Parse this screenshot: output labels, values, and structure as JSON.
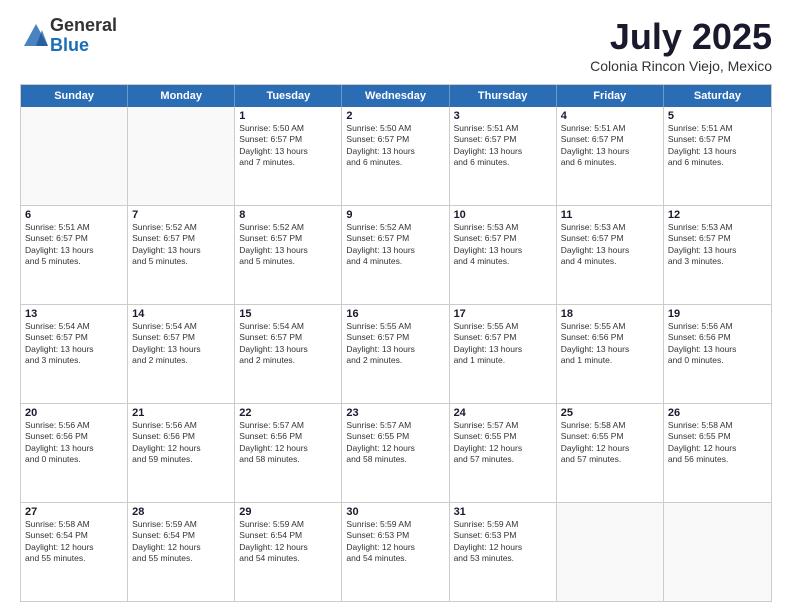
{
  "logo": {
    "general": "General",
    "blue": "Blue"
  },
  "title": "July 2025",
  "subtitle": "Colonia Rincon Viejo, Mexico",
  "header_days": [
    "Sunday",
    "Monday",
    "Tuesday",
    "Wednesday",
    "Thursday",
    "Friday",
    "Saturday"
  ],
  "weeks": [
    [
      {
        "day": "",
        "info": ""
      },
      {
        "day": "",
        "info": ""
      },
      {
        "day": "1",
        "info": "Sunrise: 5:50 AM\nSunset: 6:57 PM\nDaylight: 13 hours\nand 7 minutes."
      },
      {
        "day": "2",
        "info": "Sunrise: 5:50 AM\nSunset: 6:57 PM\nDaylight: 13 hours\nand 6 minutes."
      },
      {
        "day": "3",
        "info": "Sunrise: 5:51 AM\nSunset: 6:57 PM\nDaylight: 13 hours\nand 6 minutes."
      },
      {
        "day": "4",
        "info": "Sunrise: 5:51 AM\nSunset: 6:57 PM\nDaylight: 13 hours\nand 6 minutes."
      },
      {
        "day": "5",
        "info": "Sunrise: 5:51 AM\nSunset: 6:57 PM\nDaylight: 13 hours\nand 6 minutes."
      }
    ],
    [
      {
        "day": "6",
        "info": "Sunrise: 5:51 AM\nSunset: 6:57 PM\nDaylight: 13 hours\nand 5 minutes."
      },
      {
        "day": "7",
        "info": "Sunrise: 5:52 AM\nSunset: 6:57 PM\nDaylight: 13 hours\nand 5 minutes."
      },
      {
        "day": "8",
        "info": "Sunrise: 5:52 AM\nSunset: 6:57 PM\nDaylight: 13 hours\nand 5 minutes."
      },
      {
        "day": "9",
        "info": "Sunrise: 5:52 AM\nSunset: 6:57 PM\nDaylight: 13 hours\nand 4 minutes."
      },
      {
        "day": "10",
        "info": "Sunrise: 5:53 AM\nSunset: 6:57 PM\nDaylight: 13 hours\nand 4 minutes."
      },
      {
        "day": "11",
        "info": "Sunrise: 5:53 AM\nSunset: 6:57 PM\nDaylight: 13 hours\nand 4 minutes."
      },
      {
        "day": "12",
        "info": "Sunrise: 5:53 AM\nSunset: 6:57 PM\nDaylight: 13 hours\nand 3 minutes."
      }
    ],
    [
      {
        "day": "13",
        "info": "Sunrise: 5:54 AM\nSunset: 6:57 PM\nDaylight: 13 hours\nand 3 minutes."
      },
      {
        "day": "14",
        "info": "Sunrise: 5:54 AM\nSunset: 6:57 PM\nDaylight: 13 hours\nand 2 minutes."
      },
      {
        "day": "15",
        "info": "Sunrise: 5:54 AM\nSunset: 6:57 PM\nDaylight: 13 hours\nand 2 minutes."
      },
      {
        "day": "16",
        "info": "Sunrise: 5:55 AM\nSunset: 6:57 PM\nDaylight: 13 hours\nand 2 minutes."
      },
      {
        "day": "17",
        "info": "Sunrise: 5:55 AM\nSunset: 6:57 PM\nDaylight: 13 hours\nand 1 minute."
      },
      {
        "day": "18",
        "info": "Sunrise: 5:55 AM\nSunset: 6:56 PM\nDaylight: 13 hours\nand 1 minute."
      },
      {
        "day": "19",
        "info": "Sunrise: 5:56 AM\nSunset: 6:56 PM\nDaylight: 13 hours\nand 0 minutes."
      }
    ],
    [
      {
        "day": "20",
        "info": "Sunrise: 5:56 AM\nSunset: 6:56 PM\nDaylight: 13 hours\nand 0 minutes."
      },
      {
        "day": "21",
        "info": "Sunrise: 5:56 AM\nSunset: 6:56 PM\nDaylight: 12 hours\nand 59 minutes."
      },
      {
        "day": "22",
        "info": "Sunrise: 5:57 AM\nSunset: 6:56 PM\nDaylight: 12 hours\nand 58 minutes."
      },
      {
        "day": "23",
        "info": "Sunrise: 5:57 AM\nSunset: 6:55 PM\nDaylight: 12 hours\nand 58 minutes."
      },
      {
        "day": "24",
        "info": "Sunrise: 5:57 AM\nSunset: 6:55 PM\nDaylight: 12 hours\nand 57 minutes."
      },
      {
        "day": "25",
        "info": "Sunrise: 5:58 AM\nSunset: 6:55 PM\nDaylight: 12 hours\nand 57 minutes."
      },
      {
        "day": "26",
        "info": "Sunrise: 5:58 AM\nSunset: 6:55 PM\nDaylight: 12 hours\nand 56 minutes."
      }
    ],
    [
      {
        "day": "27",
        "info": "Sunrise: 5:58 AM\nSunset: 6:54 PM\nDaylight: 12 hours\nand 55 minutes."
      },
      {
        "day": "28",
        "info": "Sunrise: 5:59 AM\nSunset: 6:54 PM\nDaylight: 12 hours\nand 55 minutes."
      },
      {
        "day": "29",
        "info": "Sunrise: 5:59 AM\nSunset: 6:54 PM\nDaylight: 12 hours\nand 54 minutes."
      },
      {
        "day": "30",
        "info": "Sunrise: 5:59 AM\nSunset: 6:53 PM\nDaylight: 12 hours\nand 54 minutes."
      },
      {
        "day": "31",
        "info": "Sunrise: 5:59 AM\nSunset: 6:53 PM\nDaylight: 12 hours\nand 53 minutes."
      },
      {
        "day": "",
        "info": ""
      },
      {
        "day": "",
        "info": ""
      }
    ]
  ]
}
